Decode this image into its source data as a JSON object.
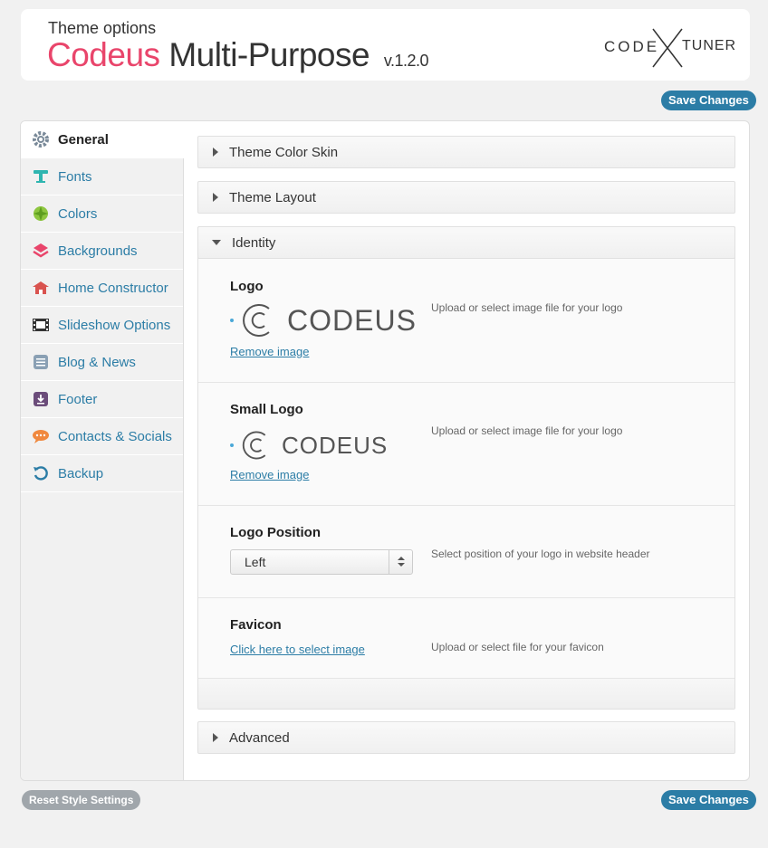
{
  "header": {
    "subtitle": "Theme options",
    "brand_accent": "Codeus",
    "brand_rest": "Multi-Purpose",
    "version": "v.1.2.0",
    "partner_logo_left": "CODE",
    "partner_logo_right": "TUNER"
  },
  "buttons": {
    "save_top": "Save Changes",
    "save_bottom": "Save Changes",
    "reset": "Reset Style Settings"
  },
  "sidebar": {
    "items": [
      {
        "label": "General",
        "icon": "gear-icon",
        "active": true,
        "color": "#7a8a99"
      },
      {
        "label": "Fonts",
        "icon": "font-icon",
        "color": "#2fb5b0"
      },
      {
        "label": "Colors",
        "icon": "palette-icon",
        "color": "#8dc63f"
      },
      {
        "label": "Backgrounds",
        "icon": "layers-icon",
        "color": "#e9456b"
      },
      {
        "label": "Home Constructor",
        "icon": "home-icon",
        "color": "#d9534f"
      },
      {
        "label": "Slideshow Options",
        "icon": "film-icon",
        "color": "#333333"
      },
      {
        "label": "Blog & News",
        "icon": "list-icon",
        "color": "#8aa0b4"
      },
      {
        "label": "Footer",
        "icon": "download-icon",
        "color": "#6b4c7a"
      },
      {
        "label": "Contacts & Socials",
        "icon": "chat-icon",
        "color": "#f0883e"
      },
      {
        "label": "Backup",
        "icon": "refresh-icon",
        "color": "#2c7da6"
      }
    ]
  },
  "sections": {
    "theme_color_skin": "Theme Color Skin",
    "theme_layout": "Theme Layout",
    "identity": "Identity",
    "advanced": "Advanced"
  },
  "identity": {
    "logo": {
      "label": "Logo",
      "logo_text": "CODEUS",
      "remove": "Remove image",
      "desc": "Upload or select image file for your logo"
    },
    "small_logo": {
      "label": "Small Logo",
      "logo_text": "CODEUS",
      "remove": "Remove image",
      "desc": "Upload or select image file for your logo"
    },
    "logo_position": {
      "label": "Logo Position",
      "value": "Left",
      "desc": "Select position of your logo in website header"
    },
    "favicon": {
      "label": "Favicon",
      "link": "Click here to select image",
      "desc": "Upload or select file for your favicon"
    }
  }
}
